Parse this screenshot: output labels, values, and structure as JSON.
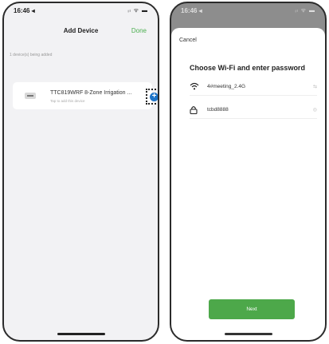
{
  "left_screen": {
    "status": {
      "time": "16:46 ◂",
      "icons": "ᵢₗ ᯤ ▬"
    },
    "nav": {
      "title": "Add Device",
      "done": "Done"
    },
    "section_label": "1 device(s) being added",
    "device": {
      "name": "TTC819WRF 8-Zone Irrigation ...",
      "subtitle": "Tap to add this device",
      "add_symbol": "+"
    }
  },
  "right_screen": {
    "status": {
      "time": "16:46 ◂",
      "icons": "ᵢₗ ᯤ ▬"
    },
    "cancel": "Cancel",
    "title": "Choose Wi-Fi and enter password",
    "wifi": {
      "icon": "wifi-icon",
      "name": "4#meeting_2.4G",
      "right": "⇆"
    },
    "password": {
      "icon": "lock-icon",
      "value": "tcbd8888",
      "right": "◎"
    },
    "next": "Next"
  },
  "colors": {
    "accent_green": "#4da84a",
    "add_blue": "#1e74c8"
  }
}
